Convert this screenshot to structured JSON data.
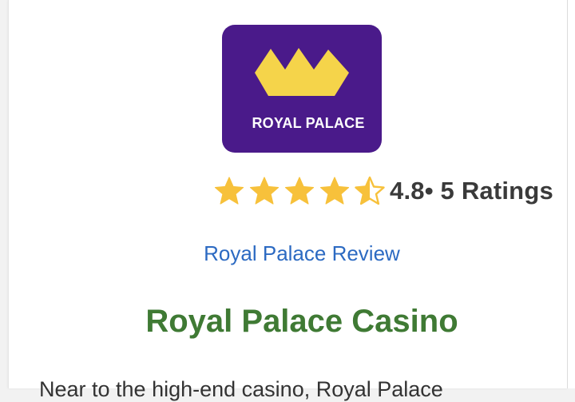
{
  "colors": {
    "logo_background": "#4a1a8a",
    "crown": "#f5d44a",
    "logo_text": "#ffffff",
    "star": "#f7c13b",
    "star_stroke": "#e0a820",
    "link": "#2c6ac2",
    "title": "#3f7a34",
    "body_text": "#333333"
  },
  "logo": {
    "icon": "crown-icon",
    "text": "ROYAL PALACE"
  },
  "rating": {
    "value": 4.8,
    "full_stars": 4,
    "half_stars": 1,
    "text": "4.8• 5 Ratings"
  },
  "review_link": "Royal Palace Review",
  "title": "Royal Palace Casino",
  "intro_text": "Near to the high-end casino, Royal Palace"
}
